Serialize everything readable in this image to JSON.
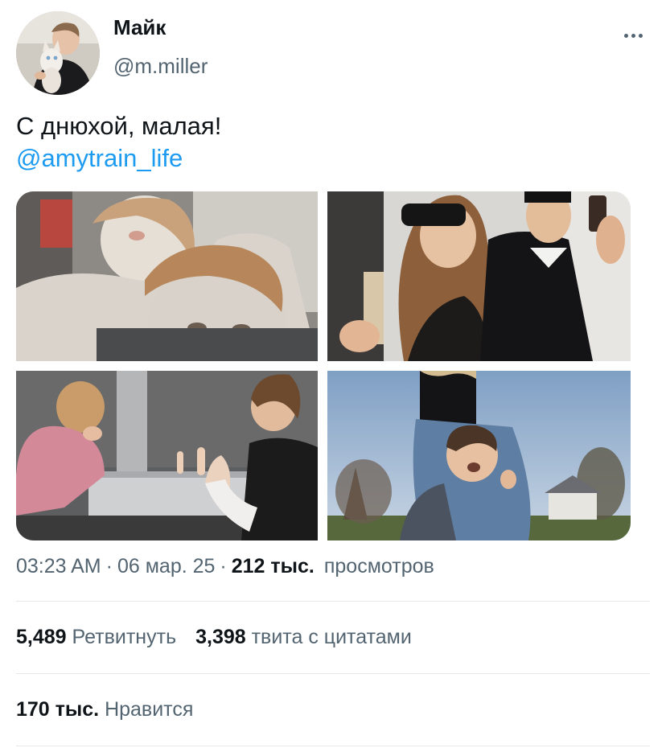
{
  "author": {
    "name": "Майк",
    "handle": "@m.miller"
  },
  "tweet": {
    "text": "С днюхой, малая!",
    "mention": "@amytrain_life"
  },
  "photos": [
    {
      "name": "photo-face-mask-selfie"
    },
    {
      "name": "photo-sunglasses-suit"
    },
    {
      "name": "photo-gesture-garage"
    },
    {
      "name": "photo-piggyback-park"
    }
  ],
  "meta": {
    "time": "03:23 AM",
    "separator": "·",
    "date": "06 мар. 25",
    "views_count": "212 тыс.",
    "views_label": "просмотров"
  },
  "stats": {
    "retweets_count": "5,489",
    "retweets_label": "Ретвитнуть",
    "quotes_count": "3,398",
    "quotes_label": "твита с цитатами",
    "likes_count": "170 тыс.",
    "likes_label": "Нравится"
  },
  "colors": {
    "link": "#1d9bf0",
    "secondary_text": "#536471",
    "primary_text": "#0f1419",
    "divider": "#e6e9ec"
  },
  "icons": {
    "more": "more-dots-icon"
  }
}
